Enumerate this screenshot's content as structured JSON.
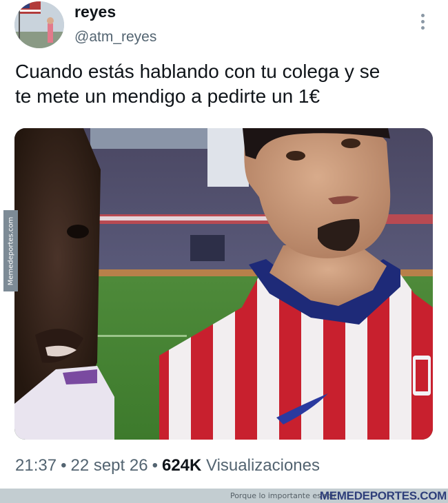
{
  "tweet": {
    "display_name": "reyes",
    "handle": "@atm_reyes",
    "text_line_1": "Cuando estás hablando con tu colega y se",
    "text_line_2": "te mete un mendigo a pedirte un 1€",
    "time": "21:37",
    "date": "22 sept 26",
    "views_count": "624K",
    "views_label": "Visualizaciones"
  },
  "icons": {
    "more": "more-options-icon"
  },
  "media": {
    "description": "photo"
  },
  "watermark": {
    "side": "Memedeportes.com",
    "tagline": "Porque lo importante es reír",
    "brand": "MEMEDEPORTES.COM"
  },
  "colors": {
    "text": "#0f1419",
    "secondary": "#536471",
    "brand": "#2e3e7a",
    "banner": "#c3cdd1",
    "shirt_red": "#c8202e",
    "collar_blue": "#1e2a78"
  }
}
